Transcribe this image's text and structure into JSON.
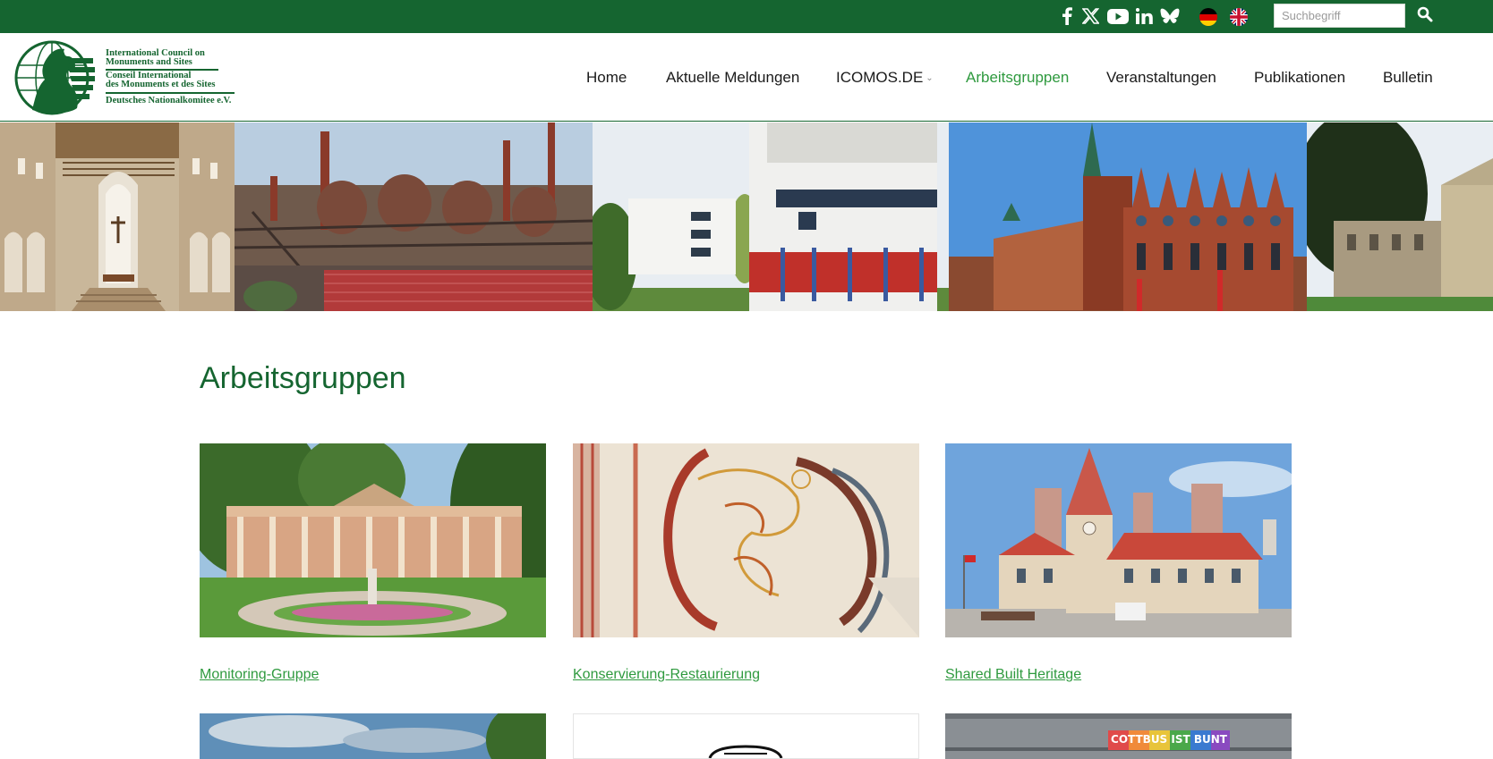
{
  "topbar": {
    "social_icons": [
      "facebook-icon",
      "x-icon",
      "youtube-icon",
      "linkedin-icon",
      "bluesky-icon"
    ],
    "languages": [
      "de-flag-icon",
      "uk-flag-icon"
    ],
    "search": {
      "placeholder": "Suchbegriff",
      "value": ""
    }
  },
  "logo": {
    "line1": "International Council on",
    "line2": "Monuments and Sites",
    "line3": "Conseil International",
    "line4": "des Monuments et des Sites",
    "line5": "Deutsches Nationalkomitee e.V."
  },
  "nav": {
    "items": [
      {
        "label": "Home"
      },
      {
        "label": "Aktuelle Meldungen"
      },
      {
        "label": "ICOMOS.DE"
      },
      {
        "label": "Arbeitsgruppen"
      },
      {
        "label": "Veranstaltungen"
      },
      {
        "label": "Publikationen"
      },
      {
        "label": "Bulletin"
      }
    ],
    "active": "Arbeitsgruppen"
  },
  "main": {
    "title": "Arbeitsgruppen",
    "cards": [
      {
        "label": "Monitoring-Gruppe"
      },
      {
        "label": "Konservierung-Restaurierung"
      },
      {
        "label": "Shared Built Heritage"
      }
    ],
    "partial_cards": [
      {
        "sign_text": "COTTBUS IST BUNT"
      }
    ]
  },
  "colors": {
    "brand_green": "#156530",
    "link_green": "#2f9a3f",
    "text": "#1a1a1a"
  }
}
